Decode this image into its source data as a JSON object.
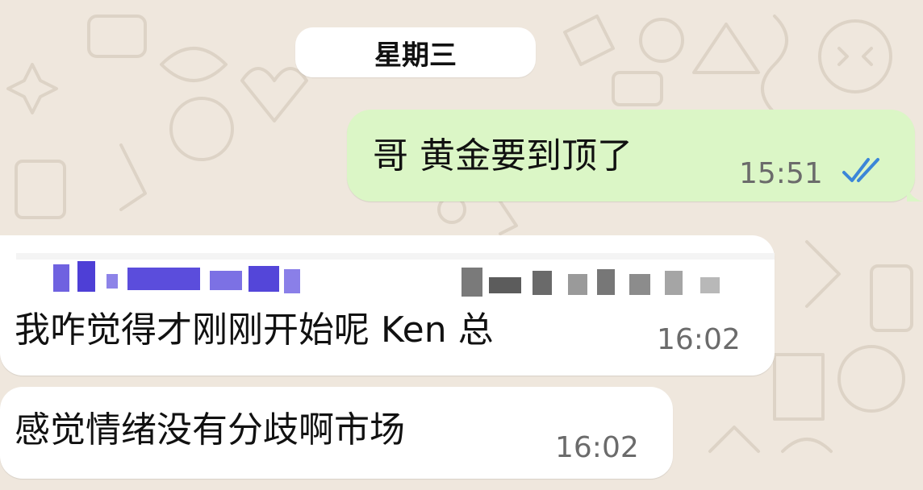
{
  "date_separator": "星期三",
  "messages": [
    {
      "direction": "outgoing",
      "text": "哥 黄金要到顶了",
      "time": "15:51",
      "status": "read"
    },
    {
      "direction": "incoming",
      "text": "我咋觉得才刚刚开始呢 Ken 总",
      "time": "16:02",
      "has_redacted_header": true
    },
    {
      "direction": "incoming",
      "text": "感觉情绪没有分歧啊市场",
      "time": "16:02"
    }
  ],
  "colors": {
    "wallpaper": "#efe7dd",
    "outgoing_bubble": "#dbf6c6",
    "incoming_bubble": "#ffffff",
    "read_ticks": "#3b86d8",
    "timestamp": "#6b6b6b"
  },
  "icons": {
    "read_receipt": "double-check-icon"
  }
}
